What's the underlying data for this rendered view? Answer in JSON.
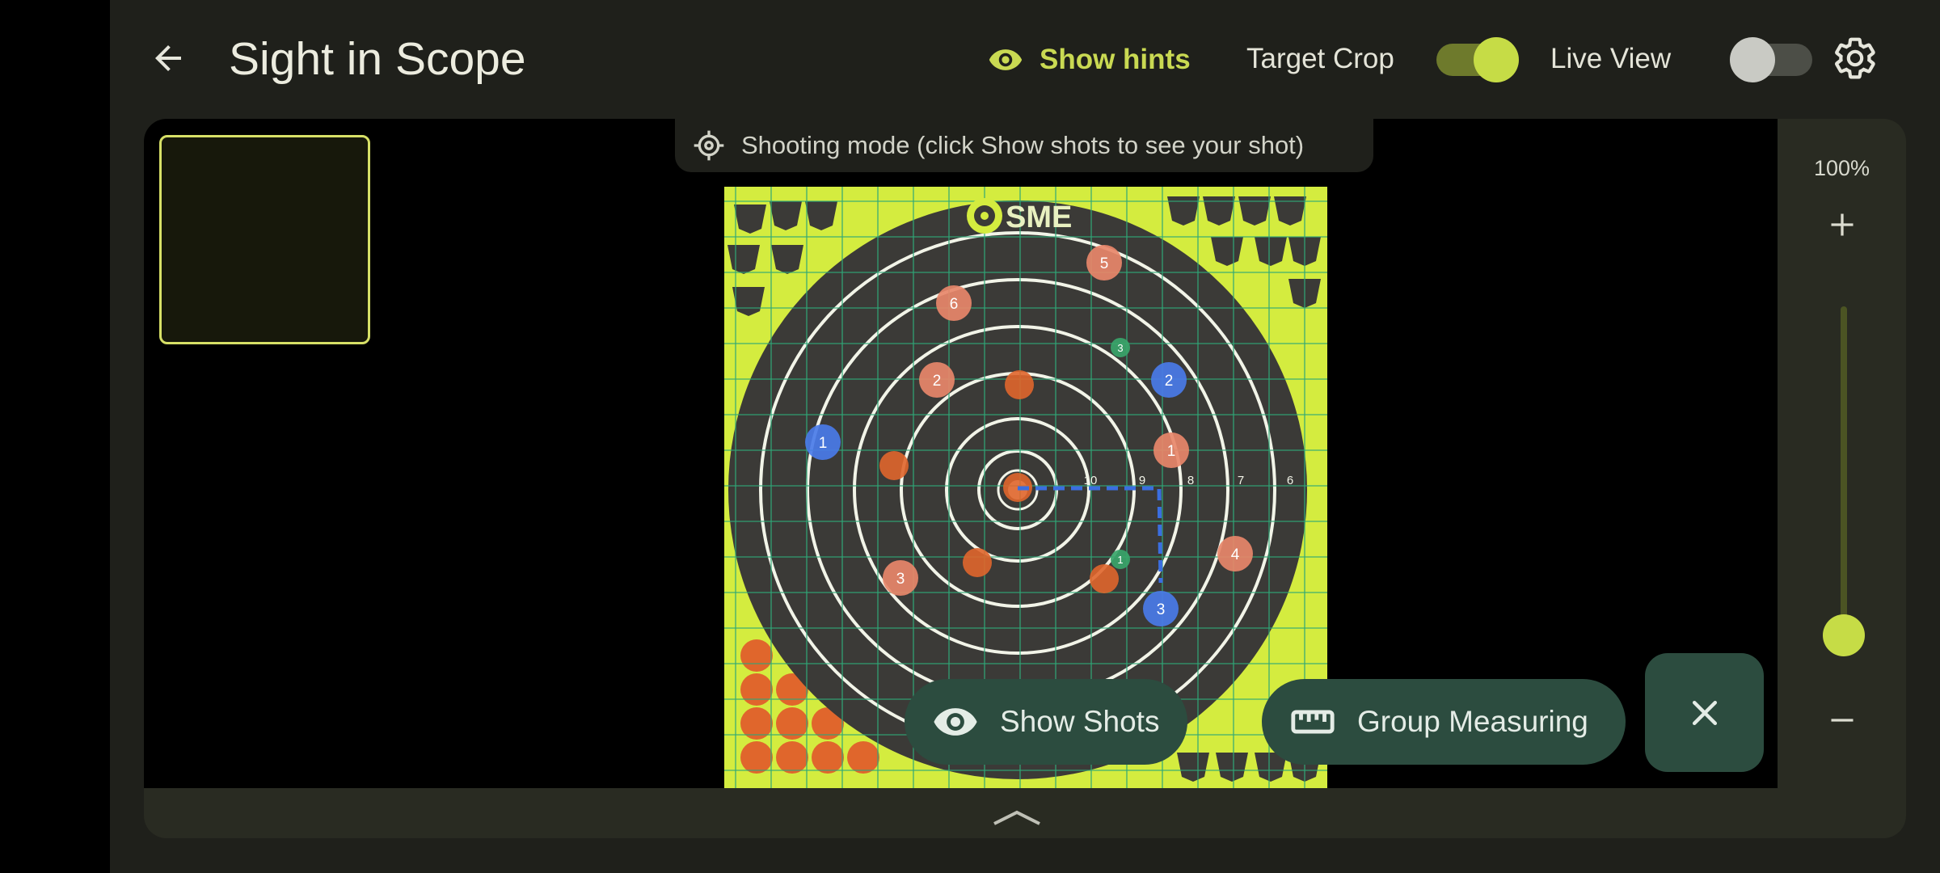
{
  "header": {
    "title": "Sight in Scope",
    "hints_label": "Show hints",
    "target_crop_label": "Target Crop",
    "target_crop_on": true,
    "live_view_label": "Live View",
    "live_view_on": false
  },
  "mode_banner": "Shooting mode (click Show shots to see your shot)",
  "target": {
    "logo_text": "SME",
    "ring_numbers": [
      "10",
      "9",
      "8",
      "7",
      "6"
    ]
  },
  "markers": [
    {
      "label": "6",
      "color": "#e8876a"
    },
    {
      "label": "5",
      "color": "#e8876a"
    },
    {
      "label": "2",
      "color": "#e8876a"
    },
    {
      "label": "1",
      "color": "#e8876a"
    },
    {
      "label": "4",
      "color": "#e8876a"
    },
    {
      "label": "3",
      "color": "#e8876a"
    },
    {
      "label": "1",
      "color": "#4a7be8"
    },
    {
      "label": "2",
      "color": "#4a7be8"
    },
    {
      "label": "3",
      "color": "#4a7be8"
    },
    {
      "label": "1",
      "color": "#3aa56a"
    },
    {
      "label": "3",
      "color": "#3aa56a"
    }
  ],
  "actions": {
    "show_shots": "Show Shots",
    "group_measuring": "Group Measuring"
  },
  "zoom": {
    "label": "100%",
    "level_fraction": 0.0
  },
  "colors": {
    "accent": "#c6dc46",
    "button_bg": "#2c4c3f",
    "background": "#1f201b",
    "panel": "#292b22"
  }
}
